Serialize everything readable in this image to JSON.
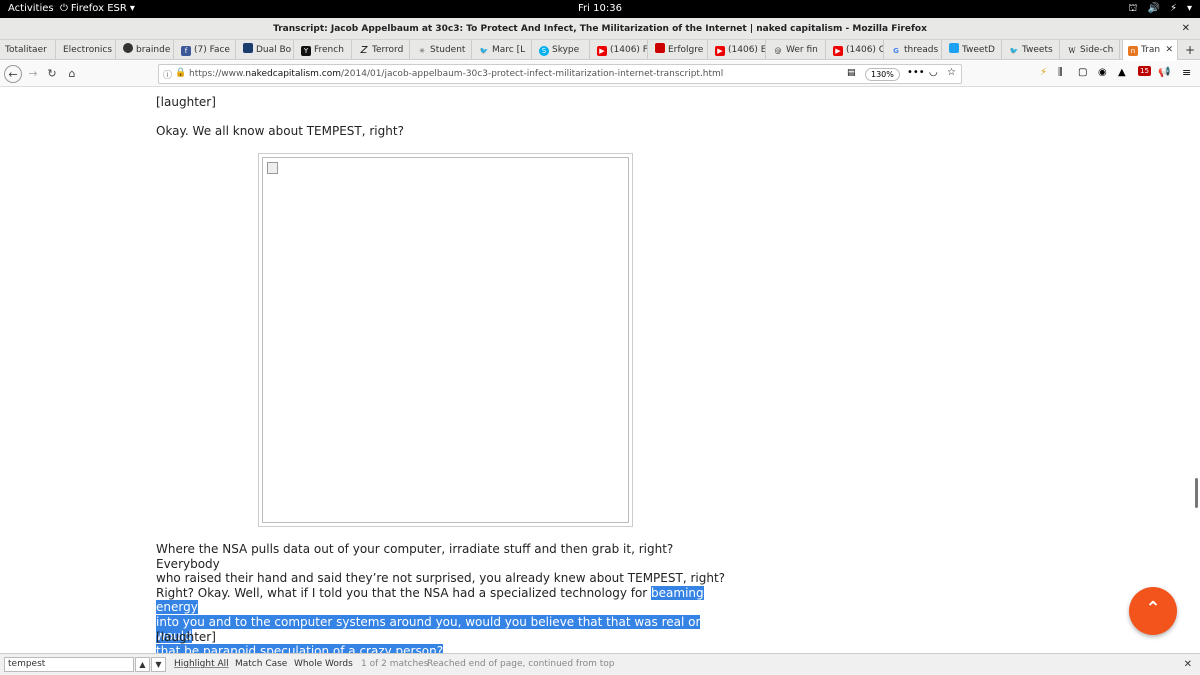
{
  "system_bar": {
    "activities": "Activities",
    "app_name": "Firefox ESR",
    "clock": "Fri 10:36"
  },
  "window": {
    "title": "Transcript: Jacob Appelbaum at 30c3: To Protect And Infect, The Militarization of the Internet | naked capitalism - Mozilla Firefox"
  },
  "tabs": [
    {
      "label": "Totalitaer"
    },
    {
      "label": "Electronics"
    },
    {
      "label": "brainde"
    },
    {
      "label": "(7) Face"
    },
    {
      "label": "Dual Bo"
    },
    {
      "label": "French"
    },
    {
      "label": "Terrord"
    },
    {
      "label": "Student"
    },
    {
      "label": "Marc [L"
    },
    {
      "label": "Skype"
    },
    {
      "label": "(1406) F"
    },
    {
      "label": "Erfolgre"
    },
    {
      "label": "(1406) E"
    },
    {
      "label": "Wer fin"
    },
    {
      "label": "(1406) C"
    },
    {
      "label": "threads"
    },
    {
      "label": "TweetD"
    },
    {
      "label": "Tweets"
    },
    {
      "label": "Side-ch"
    },
    {
      "label": "Tran"
    }
  ],
  "navbar": {
    "url_prefix": "https://www.",
    "url_domain": "nakedcapitalism.com",
    "url_path": "/2014/01/jacob-appelbaum-30c3-protect-infect-militarization-internet-transcript.html",
    "zoom": "130%",
    "badge_count": "15"
  },
  "article": {
    "p_laughter_1": "[laughter]",
    "p_tempest_question": "Okay. We all know about TEMPEST, right?",
    "p_main_lines": [
      "Where the NSA pulls data out of your computer, irradiate stuff and then grab it, right? Everybody",
      "who raised their hand and said they’re not surprised, you already knew about TEMPEST, right?",
      "Right? Okay. Well, what if I told you that the NSA had a specialized technology for "
    ],
    "p_highlight": [
      "beaming energy",
      "into you and to the computer systems around you, would you believe that that was real or would",
      "that be paranoid speculation of a crazy person?"
    ],
    "p_laughter_2": "[laughter]"
  },
  "findbar": {
    "query": "tempest",
    "highlight_all": "Highlight All",
    "match_case": "Match Case",
    "whole_words": "Whole Words",
    "match_count": "1 of 2 matches",
    "status": "Reached end of page, continued from top"
  },
  "colors": {
    "highlight": "#3583e5",
    "fab": "#f2541b"
  }
}
